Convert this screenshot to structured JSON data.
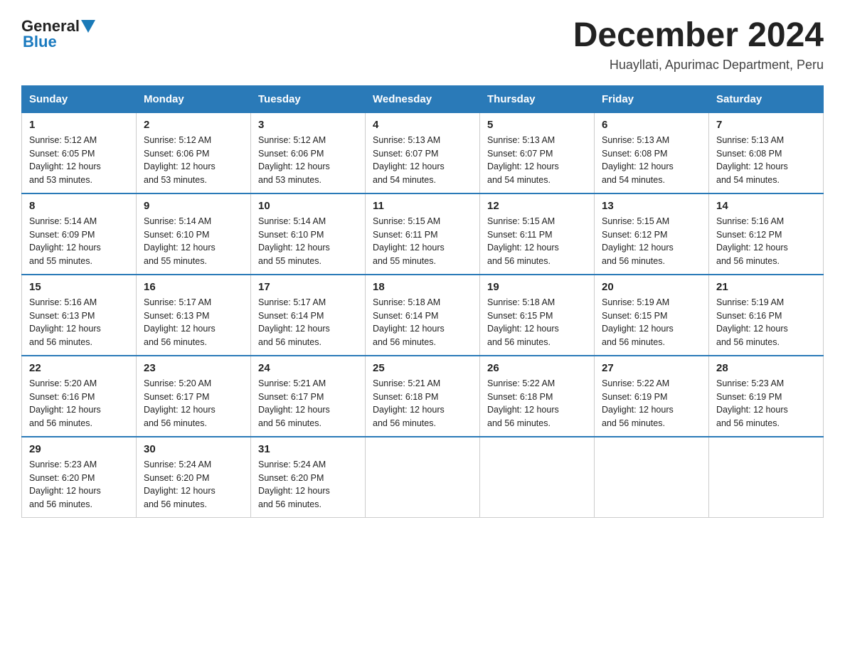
{
  "header": {
    "logo_line1": "General",
    "logo_line2": "Blue",
    "title": "December 2024",
    "subtitle": "Huayllati, Apurimac Department, Peru"
  },
  "weekdays": [
    "Sunday",
    "Monday",
    "Tuesday",
    "Wednesday",
    "Thursday",
    "Friday",
    "Saturday"
  ],
  "weeks": [
    [
      {
        "day": "1",
        "sunrise": "5:12 AM",
        "sunset": "6:05 PM",
        "daylight": "12 hours and 53 minutes."
      },
      {
        "day": "2",
        "sunrise": "5:12 AM",
        "sunset": "6:06 PM",
        "daylight": "12 hours and 53 minutes."
      },
      {
        "day": "3",
        "sunrise": "5:12 AM",
        "sunset": "6:06 PM",
        "daylight": "12 hours and 53 minutes."
      },
      {
        "day": "4",
        "sunrise": "5:13 AM",
        "sunset": "6:07 PM",
        "daylight": "12 hours and 54 minutes."
      },
      {
        "day": "5",
        "sunrise": "5:13 AM",
        "sunset": "6:07 PM",
        "daylight": "12 hours and 54 minutes."
      },
      {
        "day": "6",
        "sunrise": "5:13 AM",
        "sunset": "6:08 PM",
        "daylight": "12 hours and 54 minutes."
      },
      {
        "day": "7",
        "sunrise": "5:13 AM",
        "sunset": "6:08 PM",
        "daylight": "12 hours and 54 minutes."
      }
    ],
    [
      {
        "day": "8",
        "sunrise": "5:14 AM",
        "sunset": "6:09 PM",
        "daylight": "12 hours and 55 minutes."
      },
      {
        "day": "9",
        "sunrise": "5:14 AM",
        "sunset": "6:10 PM",
        "daylight": "12 hours and 55 minutes."
      },
      {
        "day": "10",
        "sunrise": "5:14 AM",
        "sunset": "6:10 PM",
        "daylight": "12 hours and 55 minutes."
      },
      {
        "day": "11",
        "sunrise": "5:15 AM",
        "sunset": "6:11 PM",
        "daylight": "12 hours and 55 minutes."
      },
      {
        "day": "12",
        "sunrise": "5:15 AM",
        "sunset": "6:11 PM",
        "daylight": "12 hours and 56 minutes."
      },
      {
        "day": "13",
        "sunrise": "5:15 AM",
        "sunset": "6:12 PM",
        "daylight": "12 hours and 56 minutes."
      },
      {
        "day": "14",
        "sunrise": "5:16 AM",
        "sunset": "6:12 PM",
        "daylight": "12 hours and 56 minutes."
      }
    ],
    [
      {
        "day": "15",
        "sunrise": "5:16 AM",
        "sunset": "6:13 PM",
        "daylight": "12 hours and 56 minutes."
      },
      {
        "day": "16",
        "sunrise": "5:17 AM",
        "sunset": "6:13 PM",
        "daylight": "12 hours and 56 minutes."
      },
      {
        "day": "17",
        "sunrise": "5:17 AM",
        "sunset": "6:14 PM",
        "daylight": "12 hours and 56 minutes."
      },
      {
        "day": "18",
        "sunrise": "5:18 AM",
        "sunset": "6:14 PM",
        "daylight": "12 hours and 56 minutes."
      },
      {
        "day": "19",
        "sunrise": "5:18 AM",
        "sunset": "6:15 PM",
        "daylight": "12 hours and 56 minutes."
      },
      {
        "day": "20",
        "sunrise": "5:19 AM",
        "sunset": "6:15 PM",
        "daylight": "12 hours and 56 minutes."
      },
      {
        "day": "21",
        "sunrise": "5:19 AM",
        "sunset": "6:16 PM",
        "daylight": "12 hours and 56 minutes."
      }
    ],
    [
      {
        "day": "22",
        "sunrise": "5:20 AM",
        "sunset": "6:16 PM",
        "daylight": "12 hours and 56 minutes."
      },
      {
        "day": "23",
        "sunrise": "5:20 AM",
        "sunset": "6:17 PM",
        "daylight": "12 hours and 56 minutes."
      },
      {
        "day": "24",
        "sunrise": "5:21 AM",
        "sunset": "6:17 PM",
        "daylight": "12 hours and 56 minutes."
      },
      {
        "day": "25",
        "sunrise": "5:21 AM",
        "sunset": "6:18 PM",
        "daylight": "12 hours and 56 minutes."
      },
      {
        "day": "26",
        "sunrise": "5:22 AM",
        "sunset": "6:18 PM",
        "daylight": "12 hours and 56 minutes."
      },
      {
        "day": "27",
        "sunrise": "5:22 AM",
        "sunset": "6:19 PM",
        "daylight": "12 hours and 56 minutes."
      },
      {
        "day": "28",
        "sunrise": "5:23 AM",
        "sunset": "6:19 PM",
        "daylight": "12 hours and 56 minutes."
      }
    ],
    [
      {
        "day": "29",
        "sunrise": "5:23 AM",
        "sunset": "6:20 PM",
        "daylight": "12 hours and 56 minutes."
      },
      {
        "day": "30",
        "sunrise": "5:24 AM",
        "sunset": "6:20 PM",
        "daylight": "12 hours and 56 minutes."
      },
      {
        "day": "31",
        "sunrise": "5:24 AM",
        "sunset": "6:20 PM",
        "daylight": "12 hours and 56 minutes."
      },
      null,
      null,
      null,
      null
    ]
  ],
  "labels": {
    "sunrise": "Sunrise:",
    "sunset": "Sunset:",
    "daylight": "Daylight:"
  }
}
